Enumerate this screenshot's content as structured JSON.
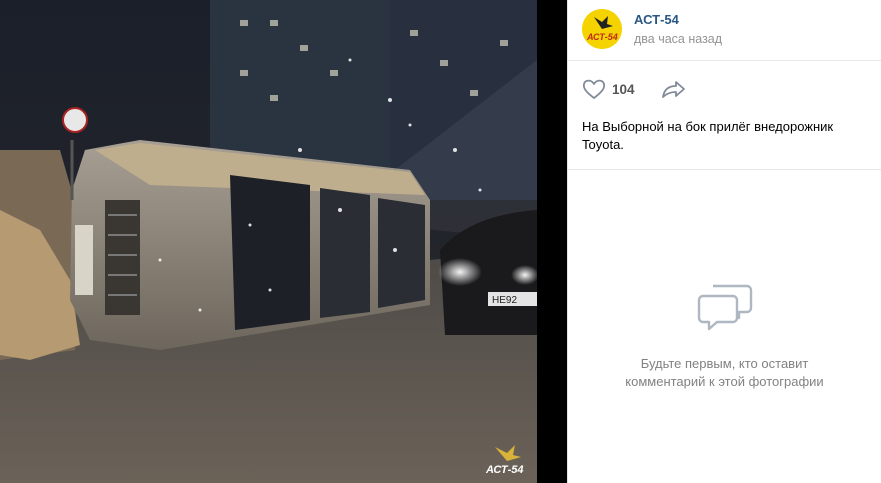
{
  "photo": {
    "alt": "Перевёрнутый внедорожник на дороге ночью",
    "watermark": "АСТ-54",
    "plate_partial": "НЕ92"
  },
  "post": {
    "author": "АСТ-54",
    "time": "два часа назад",
    "likes": "104",
    "caption": "На Выборной на бок прилёг внедорожник Toyota.",
    "avatar_text": "АСТ-54"
  },
  "comments": {
    "empty_line1": "Будьте первым, кто оставит",
    "empty_line2": "комментарий к этой фотографии"
  },
  "colors": {
    "link": "#2a5885",
    "muted": "#828282",
    "avatar_bg": "#f4d300"
  },
  "icons": {
    "like": "heart-icon",
    "share": "share-icon",
    "comments": "comments-icon"
  }
}
